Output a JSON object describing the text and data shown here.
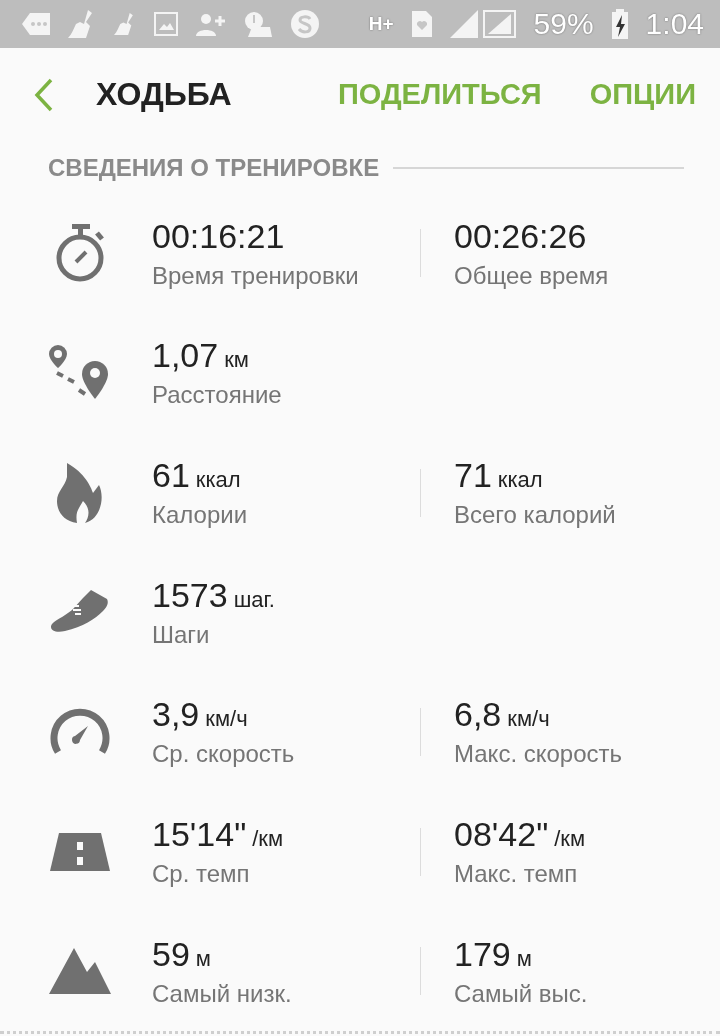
{
  "status_bar": {
    "network": "H+",
    "battery": "59%",
    "time": "1:04"
  },
  "header": {
    "title": "ХОДЬБА",
    "actions": [
      "ПОДЕЛИТЬСЯ",
      "ОПЦИИ"
    ]
  },
  "section": {
    "title": "СВЕДЕНИЯ О ТРЕНИРОВКЕ"
  },
  "stats": [
    {
      "kind": "stopwatch",
      "left": {
        "value": "00:16:21",
        "label": "Время тренировки"
      },
      "right": {
        "value": "00:26:26",
        "label": "Общее время"
      }
    },
    {
      "kind": "route",
      "left": {
        "value": "1,07",
        "unit": "км",
        "label": "Расстояние"
      }
    },
    {
      "kind": "flame",
      "left": {
        "value": "61",
        "unit": "ккал",
        "label": "Калории"
      },
      "right": {
        "value": "71",
        "unit": "ккал",
        "label": "Всего калорий"
      }
    },
    {
      "kind": "shoe",
      "left": {
        "value": "1573",
        "unit": "шаг.",
        "label": "Шаги"
      }
    },
    {
      "kind": "speed",
      "left": {
        "value": "3,9",
        "unit": "км/ч",
        "label": "Ср. скорость"
      },
      "right": {
        "value": "6,8",
        "unit": "км/ч",
        "label": "Макс. скорость"
      }
    },
    {
      "kind": "road",
      "left": {
        "value": "15'14\"",
        "unit": "/км",
        "label": "Ср. темп"
      },
      "right": {
        "value": "08'42\"",
        "unit": "/км",
        "label": "Макс. темп"
      }
    },
    {
      "kind": "mountain",
      "left": {
        "value": "59",
        "unit": "м",
        "label": "Самый низк."
      },
      "right": {
        "value": "179",
        "unit": "м",
        "label": "Самый выс."
      }
    }
  ]
}
